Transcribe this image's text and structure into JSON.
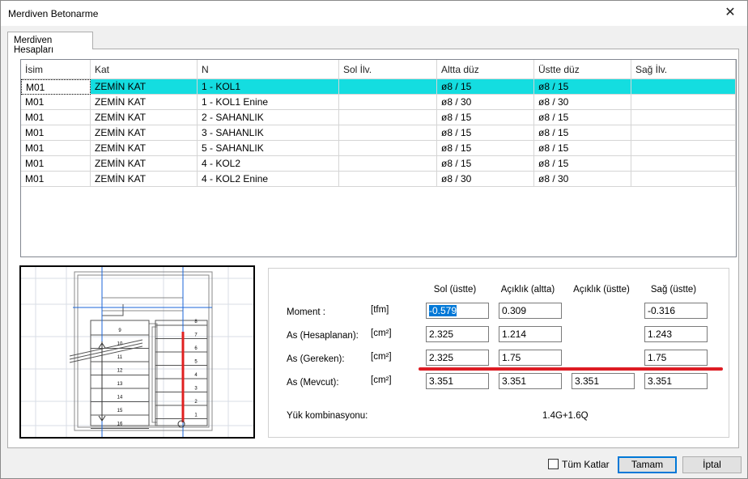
{
  "window": {
    "title": "Merdiven Betonarme",
    "close_glyph": "✕"
  },
  "tab": {
    "label": "Merdiven Hesapları"
  },
  "grid": {
    "headers": [
      "İsim",
      "Kat",
      "N",
      "Sol İlv.",
      "Altta düz",
      "Üstte düz",
      "Sağ İlv."
    ],
    "rows": [
      [
        "M01",
        "ZEMİN KAT",
        "1 - KOL1",
        "",
        "ø8 / 15",
        "ø8 / 15",
        ""
      ],
      [
        "M01",
        "ZEMİN KAT",
        "1 - KOL1 Enine",
        "",
        "ø8 / 30",
        "ø8 / 30",
        ""
      ],
      [
        "M01",
        "ZEMİN KAT",
        "2 - SAHANLIK",
        "",
        "ø8 / 15",
        "ø8 / 15",
        ""
      ],
      [
        "M01",
        "ZEMİN KAT",
        "3 - SAHANLIK",
        "",
        "ø8 / 15",
        "ø8 / 15",
        ""
      ],
      [
        "M01",
        "ZEMİN KAT",
        "5 - SAHANLIK",
        "",
        "ø8 / 15",
        "ø8 / 15",
        ""
      ],
      [
        "M01",
        "ZEMİN KAT",
        "4 - KOL2",
        "",
        "ø8 / 15",
        "ø8 / 15",
        ""
      ],
      [
        "M01",
        "ZEMİN KAT",
        "4 - KOL2 Enine",
        "",
        "ø8 / 30",
        "ø8 / 30",
        ""
      ]
    ],
    "selected_row": 0
  },
  "diagram": {
    "step_numbers_left": [
      "9",
      "10",
      "11",
      "12",
      "13",
      "14",
      "15",
      "16"
    ],
    "step_numbers_right": [
      "8",
      "7",
      "6",
      "5",
      "4",
      "3",
      "2",
      "1"
    ],
    "highlight_color": "#e02020"
  },
  "results": {
    "col_headers": [
      "Sol (üstte)",
      "Açıklık (altta)",
      "Açıklık (üstte)",
      "Sağ (üstte)"
    ],
    "rows": [
      {
        "label": "Moment :",
        "unit": "[tfm]",
        "values": [
          "-0.579",
          "0.309",
          "",
          "-0.316"
        ]
      },
      {
        "label": "As (Hesaplanan):",
        "unit": "[cm²]",
        "values": [
          "2.325",
          "1.214",
          "",
          "1.243"
        ]
      },
      {
        "label": "As (Gereken):",
        "unit": "[cm²]",
        "values": [
          "2.325",
          "1.75",
          "",
          "1.75"
        ]
      },
      {
        "label": "As (Mevcut):",
        "unit": "[cm²]",
        "values": [
          "3.351",
          "3.351",
          "3.351",
          "3.351"
        ]
      }
    ],
    "combo_label": "Yük kombinasyonu:",
    "combo_value": "1.4G+1.6Q",
    "highlight_color": "#dd1c24"
  },
  "footer": {
    "all_floors_label": "Tüm Katlar",
    "all_floors_checked": false,
    "ok_label": "Tamam",
    "cancel_label": "İptal"
  }
}
